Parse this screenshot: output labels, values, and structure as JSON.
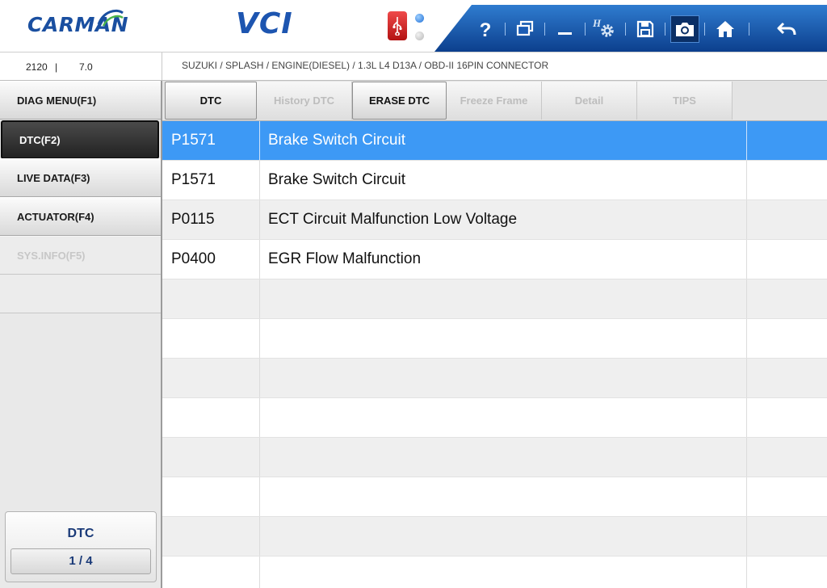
{
  "header": {
    "brand": "CARMAN",
    "product": "VCI",
    "toolbar": [
      {
        "icon": "help-icon"
      },
      {
        "icon": "window-restore-icon"
      },
      {
        "icon": "minimize-icon"
      },
      {
        "icon": "settings-icon"
      },
      {
        "icon": "save-icon"
      },
      {
        "icon": "camera-icon"
      },
      {
        "icon": "home-icon"
      },
      {
        "icon": "back-icon"
      }
    ]
  },
  "info": {
    "code": "2120",
    "separator": "|",
    "version": "7.0",
    "vehicle_path": "SUZUKI / SPLASH / ENGINE(DIESEL) / 1.3L L4 D13A / OBD-II 16PIN CONNECTOR"
  },
  "sidebar": {
    "items": [
      {
        "label": "DIAG MENU(F1)",
        "state": "normal"
      },
      {
        "label": "DTC(F2)",
        "state": "active"
      },
      {
        "label": "LIVE DATA(F3)",
        "state": "normal"
      },
      {
        "label": "ACTUATOR(F4)",
        "state": "normal"
      },
      {
        "label": "SYS.INFO(F5)",
        "state": "disabled"
      }
    ],
    "counter": {
      "label": "DTC",
      "value": "1 / 4"
    }
  },
  "tabs": [
    {
      "label": "DTC",
      "enabled": true
    },
    {
      "label": "History DTC",
      "enabled": false
    },
    {
      "label": "ERASE DTC",
      "enabled": true
    },
    {
      "label": "Freeze Frame",
      "enabled": false
    },
    {
      "label": "Detail",
      "enabled": false
    },
    {
      "label": "TIPS",
      "enabled": false
    }
  ],
  "dtc_rows": [
    {
      "code": "P1571",
      "description": "Brake Switch Circuit",
      "selected": true
    },
    {
      "code": "P1571",
      "description": "Brake Switch Circuit",
      "selected": false
    },
    {
      "code": "P0115",
      "description": "ECT Circuit Malfunction Low Voltage",
      "selected": false
    },
    {
      "code": "P0400",
      "description": "EGR Flow Malfunction",
      "selected": false
    }
  ],
  "colors": {
    "selected_row": "#3d99f5",
    "brand_blue": "#1a4fa0",
    "toolbar_blue": "#1b5db5"
  }
}
